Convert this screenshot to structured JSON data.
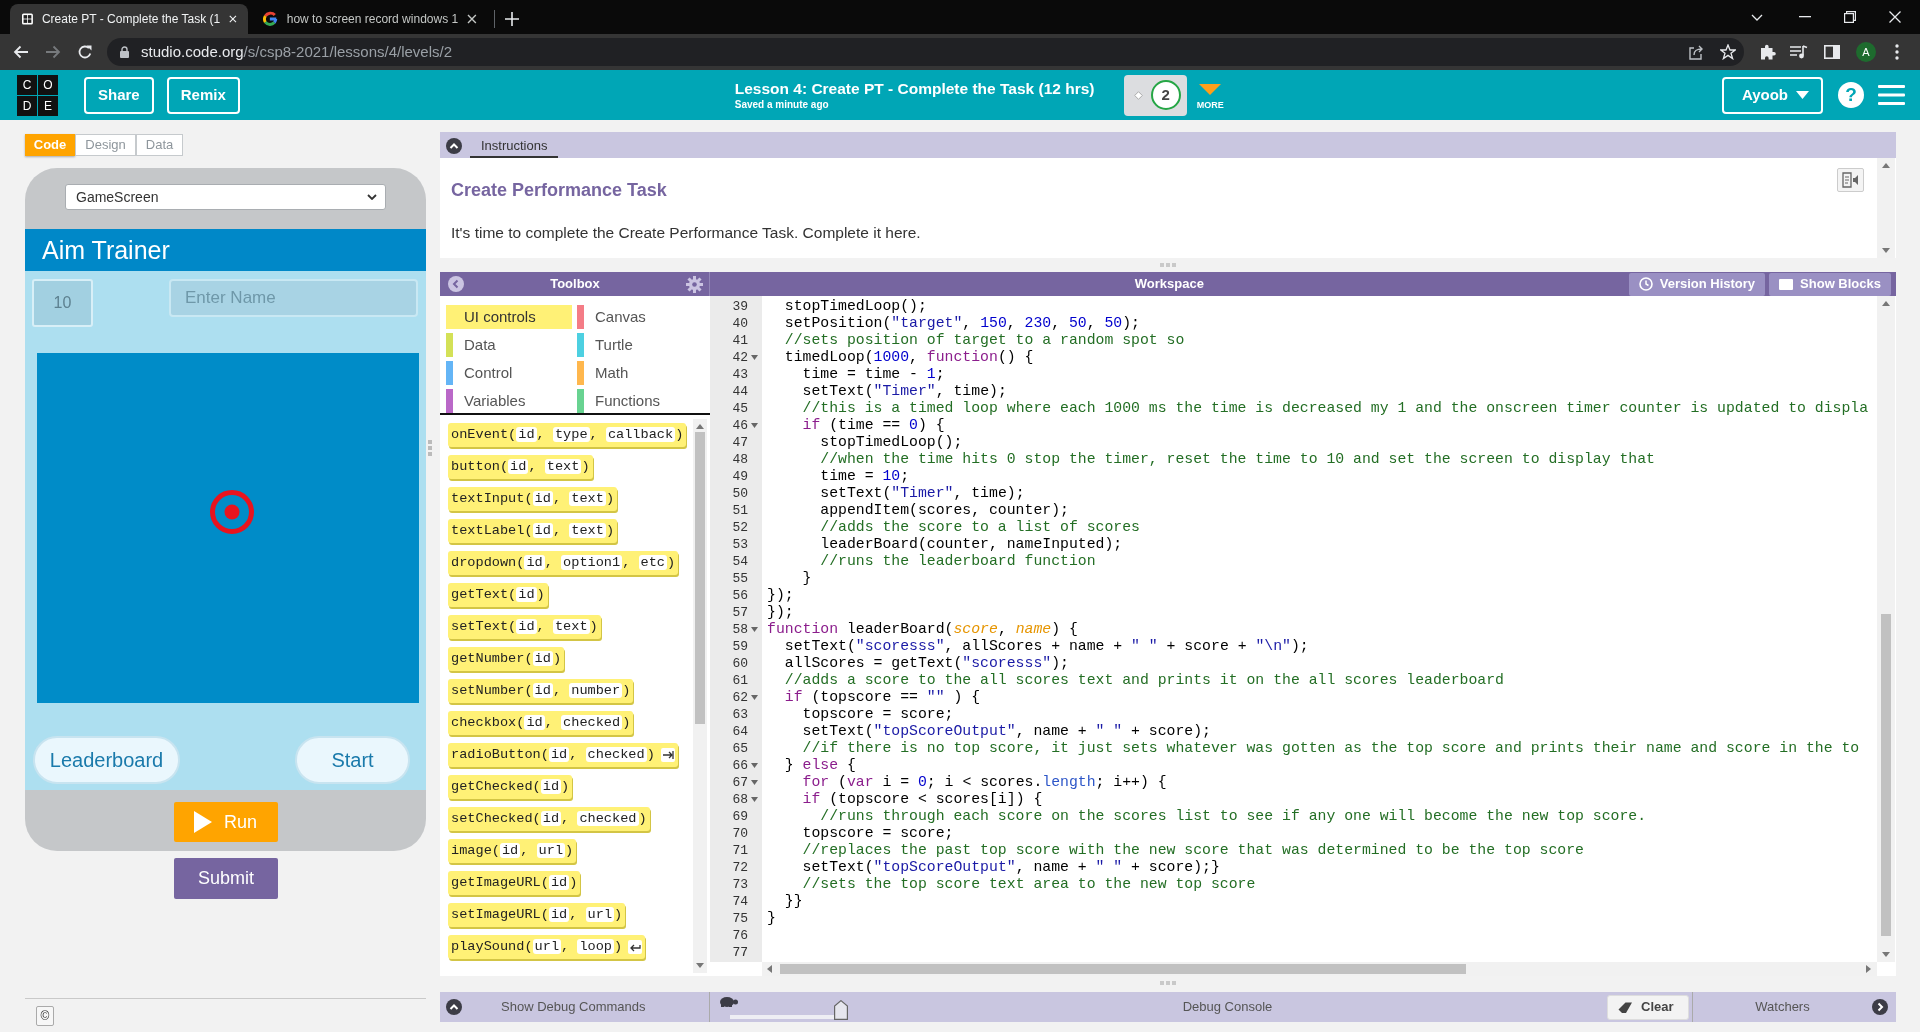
{
  "browser": {
    "tabs": [
      {
        "kind": "grid",
        "title": "Create PT - Complete the Task (1",
        "selected": true
      },
      {
        "kind": "google",
        "title": "how to screen record windows 1",
        "selected": false
      }
    ],
    "nav_buttons": [
      {
        "kind": "back",
        "disabled": false
      },
      {
        "kind": "forward",
        "disabled": true
      },
      {
        "kind": "reload",
        "disabled": false
      }
    ],
    "address": {
      "host": "studio.code.org",
      "path": "/s/csp8-2021/lessons/4/levels/2"
    },
    "profile_initial": "A"
  },
  "header": {
    "logo": [
      "C",
      "O",
      "D",
      "E"
    ],
    "buttons": [
      "Share",
      "Remix"
    ],
    "lesson_title": "Lesson 4: Create PT - Complete the Task (12 hrs)",
    "save_status": "Saved a minute ago",
    "level_bubble": "2",
    "more": "MORE",
    "user": "Ayoob",
    "help": "?"
  },
  "mode_tabs": [
    {
      "label": "Code",
      "selected": true
    },
    {
      "label": "Design",
      "selected": false
    },
    {
      "label": "Data",
      "selected": false
    }
  ],
  "app_preview": {
    "screen": "GameScreen",
    "title": "Aim Trainer",
    "timer": "10",
    "name_field": {
      "placeholder": "Enter Name"
    },
    "buttons": [
      "Leaderboard",
      "Start"
    ]
  },
  "run_button": "Run",
  "submit_button": "Submit",
  "copyright": "©",
  "instructions": {
    "tab": "Instructions",
    "heading": "Create Performance Task",
    "text": "It's time to complete the Create Performance Task. Complete it here."
  },
  "toolbox": {
    "title": "Toolbox",
    "categories": [
      {
        "label": "UI controls",
        "color": "#fff176",
        "selected": true
      },
      {
        "label": "Canvas",
        "color": "#f47c86",
        "selected": false
      },
      {
        "label": "Data",
        "color": "#d4e157",
        "selected": false
      },
      {
        "label": "Turtle",
        "color": "#4dd0e1",
        "selected": false
      },
      {
        "label": "Control",
        "color": "#64b5f6",
        "selected": false
      },
      {
        "label": "Math",
        "color": "#ffb74d",
        "selected": false
      },
      {
        "label": "Variables",
        "color": "#ba68c8",
        "selected": false
      },
      {
        "label": "Functions",
        "color": "#68d391",
        "selected": false
      }
    ],
    "blocks": [
      {
        "kind": "plain",
        "tokens": [
          {
            "kind": "plain",
            "text": "onEvent("
          },
          {
            "kind": "param",
            "text": "id"
          },
          {
            "kind": "plain",
            "text": ", "
          },
          {
            "kind": "param",
            "text": "type"
          },
          {
            "kind": "plain",
            "text": ", "
          },
          {
            "kind": "param",
            "text": "callback"
          },
          {
            "kind": "plain",
            "text": ")"
          }
        ]
      },
      {
        "kind": "plain",
        "tokens": [
          {
            "kind": "plain",
            "text": "button("
          },
          {
            "kind": "param",
            "text": "id"
          },
          {
            "kind": "plain",
            "text": ", "
          },
          {
            "kind": "param",
            "text": "text"
          },
          {
            "kind": "plain",
            "text": ")"
          }
        ]
      },
      {
        "kind": "plain",
        "tokens": [
          {
            "kind": "plain",
            "text": "textInput("
          },
          {
            "kind": "param",
            "text": "id"
          },
          {
            "kind": "plain",
            "text": ", "
          },
          {
            "kind": "param",
            "text": "text"
          },
          {
            "kind": "plain",
            "text": ")"
          }
        ]
      },
      {
        "kind": "plain",
        "tokens": [
          {
            "kind": "plain",
            "text": "textLabel("
          },
          {
            "kind": "param",
            "text": "id"
          },
          {
            "kind": "plain",
            "text": ", "
          },
          {
            "kind": "param",
            "text": "text"
          },
          {
            "kind": "plain",
            "text": ")"
          }
        ]
      },
      {
        "kind": "plain",
        "tokens": [
          {
            "kind": "plain",
            "text": "dropdown("
          },
          {
            "kind": "param",
            "text": "id"
          },
          {
            "kind": "plain",
            "text": ", "
          },
          {
            "kind": "param",
            "text": "option1"
          },
          {
            "kind": "plain",
            "text": ", "
          },
          {
            "kind": "param",
            "text": "etc"
          },
          {
            "kind": "plain",
            "text": ")"
          }
        ]
      },
      {
        "kind": "plain",
        "tokens": [
          {
            "kind": "plain",
            "text": "getText("
          },
          {
            "kind": "param",
            "text": "id"
          },
          {
            "kind": "plain",
            "text": ")"
          }
        ]
      },
      {
        "kind": "plain",
        "tokens": [
          {
            "kind": "plain",
            "text": "setText("
          },
          {
            "kind": "param",
            "text": "id"
          },
          {
            "kind": "plain",
            "text": ", "
          },
          {
            "kind": "param",
            "text": "text"
          },
          {
            "kind": "plain",
            "text": ")"
          }
        ]
      },
      {
        "kind": "plain",
        "tokens": [
          {
            "kind": "plain",
            "text": "getNumber("
          },
          {
            "kind": "param",
            "text": "id"
          },
          {
            "kind": "plain",
            "text": ")"
          }
        ]
      },
      {
        "kind": "plain",
        "tokens": [
          {
            "kind": "plain",
            "text": "setNumber("
          },
          {
            "kind": "param",
            "text": "id"
          },
          {
            "kind": "plain",
            "text": ", "
          },
          {
            "kind": "param",
            "text": "number"
          },
          {
            "kind": "plain",
            "text": ")"
          }
        ]
      },
      {
        "kind": "plain",
        "tokens": [
          {
            "kind": "plain",
            "text": "checkbox("
          },
          {
            "kind": "param",
            "text": "id"
          },
          {
            "kind": "plain",
            "text": ", "
          },
          {
            "kind": "param",
            "text": "checked"
          },
          {
            "kind": "plain",
            "text": ")"
          }
        ]
      },
      {
        "kind": "rightarrow",
        "tokens": [
          {
            "kind": "plain",
            "text": "radioButton("
          },
          {
            "kind": "param",
            "text": "id"
          },
          {
            "kind": "plain",
            "text": ", "
          },
          {
            "kind": "param",
            "text": "checked"
          },
          {
            "kind": "plain",
            "text": ")"
          }
        ]
      },
      {
        "kind": "plain",
        "tokens": [
          {
            "kind": "plain",
            "text": "getChecked("
          },
          {
            "kind": "param",
            "text": "id"
          },
          {
            "kind": "plain",
            "text": ")"
          }
        ]
      },
      {
        "kind": "plain",
        "tokens": [
          {
            "kind": "plain",
            "text": "setChecked("
          },
          {
            "kind": "param",
            "text": "id"
          },
          {
            "kind": "plain",
            "text": ", "
          },
          {
            "kind": "param",
            "text": "checked"
          },
          {
            "kind": "plain",
            "text": ")"
          }
        ]
      },
      {
        "kind": "plain",
        "tokens": [
          {
            "kind": "plain",
            "text": "image("
          },
          {
            "kind": "param",
            "text": "id"
          },
          {
            "kind": "plain",
            "text": ", "
          },
          {
            "kind": "param",
            "text": "url"
          },
          {
            "kind": "plain",
            "text": ")"
          }
        ]
      },
      {
        "kind": "plain",
        "tokens": [
          {
            "kind": "plain",
            "text": "getImageURL("
          },
          {
            "kind": "param",
            "text": "id"
          },
          {
            "kind": "plain",
            "text": ")"
          }
        ]
      },
      {
        "kind": "plain",
        "tokens": [
          {
            "kind": "plain",
            "text": "setImageURL("
          },
          {
            "kind": "param",
            "text": "id"
          },
          {
            "kind": "plain",
            "text": ", "
          },
          {
            "kind": "param",
            "text": "url"
          },
          {
            "kind": "plain",
            "text": ")"
          }
        ]
      },
      {
        "kind": "leftarrow",
        "tokens": [
          {
            "kind": "plain",
            "text": "playSound("
          },
          {
            "kind": "param",
            "text": "url"
          },
          {
            "kind": "plain",
            "text": ", "
          },
          {
            "kind": "param",
            "text": "loop"
          },
          {
            "kind": "plain",
            "text": ")"
          }
        ]
      }
    ]
  },
  "workspace": {
    "title": "Workspace",
    "buttons": [
      {
        "kind": "history",
        "label": "Version History"
      },
      {
        "kind": "blocks",
        "label": "Show Blocks"
      }
    ],
    "lines": [
      {
        "number": "39",
        "foldable": false,
        "tokens": [
          {
            "kind": "plain",
            "text": "  stopTimedLoop();"
          }
        ]
      },
      {
        "number": "40",
        "foldable": false,
        "tokens": [
          {
            "kind": "plain",
            "text": "  setPosition("
          },
          {
            "kind": "string",
            "text": "\"target\""
          },
          {
            "kind": "plain",
            "text": ", "
          },
          {
            "kind": "number",
            "text": "150"
          },
          {
            "kind": "plain",
            "text": ", "
          },
          {
            "kind": "number",
            "text": "230"
          },
          {
            "kind": "plain",
            "text": ", "
          },
          {
            "kind": "number",
            "text": "50"
          },
          {
            "kind": "plain",
            "text": ", "
          },
          {
            "kind": "number",
            "text": "50"
          },
          {
            "kind": "plain",
            "text": ");"
          }
        ]
      },
      {
        "number": "41",
        "foldable": false,
        "tokens": [
          {
            "kind": "comment",
            "text": "  //sets position of target to a random spot so"
          }
        ]
      },
      {
        "number": "42",
        "foldable": true,
        "tokens": [
          {
            "kind": "plain",
            "text": "  timedLoop("
          },
          {
            "kind": "number",
            "text": "1000"
          },
          {
            "kind": "plain",
            "text": ", "
          },
          {
            "kind": "keyword",
            "text": "function"
          },
          {
            "kind": "plain",
            "text": "() {"
          }
        ]
      },
      {
        "number": "43",
        "foldable": false,
        "tokens": [
          {
            "kind": "plain",
            "text": "    time = time - "
          },
          {
            "kind": "number",
            "text": "1"
          },
          {
            "kind": "plain",
            "text": ";"
          }
        ]
      },
      {
        "number": "44",
        "foldable": false,
        "tokens": [
          {
            "kind": "plain",
            "text": "    setText("
          },
          {
            "kind": "string",
            "text": "\"Timer\""
          },
          {
            "kind": "plain",
            "text": ", time);"
          }
        ]
      },
      {
        "number": "45",
        "foldable": false,
        "tokens": [
          {
            "kind": "comment",
            "text": "    //this is a timed loop where each 1000 ms the time is decreased my 1 and the onscreen timer counter is updated to displa"
          }
        ]
      },
      {
        "number": "46",
        "foldable": true,
        "tokens": [
          {
            "kind": "keyword",
            "text": "    if"
          },
          {
            "kind": "plain",
            "text": " (time == "
          },
          {
            "kind": "number",
            "text": "0"
          },
          {
            "kind": "plain",
            "text": ") {"
          }
        ]
      },
      {
        "number": "47",
        "foldable": false,
        "tokens": [
          {
            "kind": "plain",
            "text": "      stopTimedLoop();"
          }
        ]
      },
      {
        "number": "48",
        "foldable": false,
        "tokens": [
          {
            "kind": "comment",
            "text": "      //when the time hits 0 stop the timer, reset the time to 10 and set the screen to display that"
          }
        ]
      },
      {
        "number": "49",
        "foldable": false,
        "tokens": [
          {
            "kind": "plain",
            "text": "      time = "
          },
          {
            "kind": "number",
            "text": "10"
          },
          {
            "kind": "plain",
            "text": ";"
          }
        ]
      },
      {
        "number": "50",
        "foldable": false,
        "tokens": [
          {
            "kind": "plain",
            "text": "      setText("
          },
          {
            "kind": "string",
            "text": "\"Timer\""
          },
          {
            "kind": "plain",
            "text": ", time);"
          }
        ]
      },
      {
        "number": "51",
        "foldable": false,
        "tokens": [
          {
            "kind": "plain",
            "text": "      appendItem(scores, counter);"
          }
        ]
      },
      {
        "number": "52",
        "foldable": false,
        "tokens": [
          {
            "kind": "comment",
            "text": "      //adds the score to a list of scores"
          }
        ]
      },
      {
        "number": "53",
        "foldable": false,
        "tokens": [
          {
            "kind": "plain",
            "text": "      leaderBoard(counter, nameInputed);"
          }
        ]
      },
      {
        "number": "54",
        "foldable": false,
        "tokens": [
          {
            "kind": "comment",
            "text": "      //runs the leaderboard function"
          }
        ]
      },
      {
        "number": "55",
        "foldable": false,
        "tokens": [
          {
            "kind": "plain",
            "text": "    }"
          }
        ]
      },
      {
        "number": "56",
        "foldable": false,
        "tokens": [
          {
            "kind": "plain",
            "text": "});"
          }
        ]
      },
      {
        "number": "57",
        "foldable": false,
        "tokens": [
          {
            "kind": "plain",
            "text": "});"
          }
        ]
      },
      {
        "number": "58",
        "foldable": true,
        "tokens": [
          {
            "kind": "keyword",
            "text": "function"
          },
          {
            "kind": "plain",
            "text": " leaderBoard("
          },
          {
            "kind": "param",
            "text": "score"
          },
          {
            "kind": "plain",
            "text": ", "
          },
          {
            "kind": "param",
            "text": "name"
          },
          {
            "kind": "plain",
            "text": ") {"
          }
        ]
      },
      {
        "number": "59",
        "foldable": false,
        "tokens": [
          {
            "kind": "plain",
            "text": "  setText("
          },
          {
            "kind": "string",
            "text": "\"scoresss\""
          },
          {
            "kind": "plain",
            "text": ", allScores + name + "
          },
          {
            "kind": "string",
            "text": "\" \""
          },
          {
            "kind": "plain",
            "text": " + score + "
          },
          {
            "kind": "string",
            "text": "\"\\n\""
          },
          {
            "kind": "plain",
            "text": ");"
          }
        ]
      },
      {
        "number": "60",
        "foldable": false,
        "tokens": [
          {
            "kind": "plain",
            "text": "  allScores = getText("
          },
          {
            "kind": "string",
            "text": "\"scoresss\""
          },
          {
            "kind": "plain",
            "text": ");"
          }
        ]
      },
      {
        "number": "61",
        "foldable": false,
        "tokens": [
          {
            "kind": "comment",
            "text": "  //adds a score to the all scores text and prints it on the all scores leaderboard"
          }
        ]
      },
      {
        "number": "62",
        "foldable": true,
        "tokens": [
          {
            "kind": "keyword",
            "text": "  if"
          },
          {
            "kind": "plain",
            "text": " (topscore == "
          },
          {
            "kind": "string",
            "text": "\"\""
          },
          {
            "kind": "plain",
            "text": " ) {"
          }
        ]
      },
      {
        "number": "63",
        "foldable": false,
        "tokens": [
          {
            "kind": "plain",
            "text": "    topscore = score;"
          }
        ]
      },
      {
        "number": "64",
        "foldable": false,
        "tokens": [
          {
            "kind": "plain",
            "text": "    setText("
          },
          {
            "kind": "string",
            "text": "\"topScoreOutput\""
          },
          {
            "kind": "plain",
            "text": ", name + "
          },
          {
            "kind": "string",
            "text": "\" \""
          },
          {
            "kind": "plain",
            "text": " + score);"
          }
        ]
      },
      {
        "number": "65",
        "foldable": false,
        "tokens": [
          {
            "kind": "comment",
            "text": "    //if there is no top score, it just sets whatever was gotten as the top score and prints their name and score in the to"
          }
        ]
      },
      {
        "number": "66",
        "foldable": true,
        "tokens": [
          {
            "kind": "plain",
            "text": "  } "
          },
          {
            "kind": "keyword",
            "text": "else"
          },
          {
            "kind": "plain",
            "text": " {"
          }
        ]
      },
      {
        "number": "67",
        "foldable": true,
        "tokens": [
          {
            "kind": "keyword",
            "text": "    for"
          },
          {
            "kind": "plain",
            "text": " ("
          },
          {
            "kind": "keyword",
            "text": "var"
          },
          {
            "kind": "plain",
            "text": " i = "
          },
          {
            "kind": "number",
            "text": "0"
          },
          {
            "kind": "plain",
            "text": "; i < scores."
          },
          {
            "kind": "property",
            "text": "length"
          },
          {
            "kind": "plain",
            "text": "; i++) {"
          }
        ]
      },
      {
        "number": "68",
        "foldable": true,
        "tokens": [
          {
            "kind": "keyword",
            "text": "    if"
          },
          {
            "kind": "plain",
            "text": " (topscore < scores[i]) {"
          }
        ]
      },
      {
        "number": "69",
        "foldable": false,
        "tokens": [
          {
            "kind": "comment",
            "text": "      //runs through each score on the scores list to see if any one will become the new top score."
          }
        ]
      },
      {
        "number": "70",
        "foldable": false,
        "tokens": [
          {
            "kind": "plain",
            "text": "    topscore = score;"
          }
        ]
      },
      {
        "number": "71",
        "foldable": false,
        "tokens": [
          {
            "kind": "comment",
            "text": "    //replaces the past top score with the new score that was determined to be the top score"
          }
        ]
      },
      {
        "number": "72",
        "foldable": false,
        "tokens": [
          {
            "kind": "plain",
            "text": "    setText("
          },
          {
            "kind": "string",
            "text": "\"topScoreOutput\""
          },
          {
            "kind": "plain",
            "text": ", name + "
          },
          {
            "kind": "string",
            "text": "\" \""
          },
          {
            "kind": "plain",
            "text": " + score);}"
          }
        ]
      },
      {
        "number": "73",
        "foldable": false,
        "tokens": [
          {
            "kind": "comment",
            "text": "    //sets the top score text area to the new top score"
          }
        ]
      },
      {
        "number": "74",
        "foldable": false,
        "tokens": [
          {
            "kind": "plain",
            "text": "  }}"
          }
        ]
      },
      {
        "number": "75",
        "foldable": false,
        "tokens": [
          {
            "kind": "plain",
            "text": "}"
          }
        ]
      },
      {
        "number": "76",
        "foldable": false
      },
      {
        "number": "77",
        "foldable": false
      }
    ]
  },
  "debug": {
    "toggle": "Show Debug Commands",
    "speed": {
      "level": 1
    },
    "console": "Debug Console",
    "clear": "Clear",
    "watchers": "Watchers"
  }
}
